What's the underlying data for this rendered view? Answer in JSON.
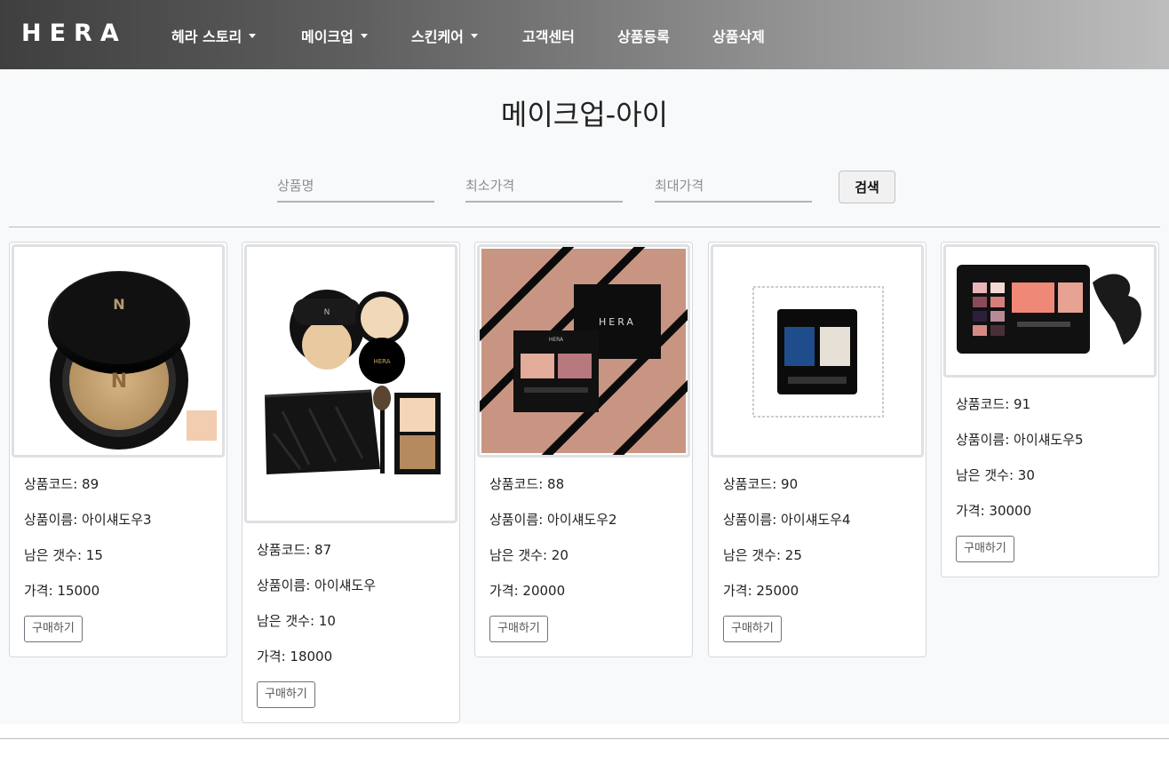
{
  "nav": {
    "brand": "HERA",
    "items": [
      {
        "label": "헤라 스토리",
        "dropdown": true
      },
      {
        "label": "메이크업",
        "dropdown": true
      },
      {
        "label": "스킨케어",
        "dropdown": true
      },
      {
        "label": "고객센터",
        "dropdown": false
      },
      {
        "label": "상품등록",
        "dropdown": false
      },
      {
        "label": "상품삭제",
        "dropdown": false
      }
    ]
  },
  "page": {
    "title": "메이크업-아이"
  },
  "search": {
    "name_placeholder": "상품명",
    "min_price_placeholder": "최소가격",
    "max_price_placeholder": "최대가격",
    "button_label": "검색"
  },
  "products": [
    {
      "code_line": "상품코드: 89",
      "name_line": "상품이름: 아이섀도우3",
      "stock_line": "남은 갯수: 15",
      "price_line": "가격: 15000",
      "buy_label": "구매하기",
      "image_icon": "cushion-compact-icon"
    },
    {
      "code_line": "상품코드: 87",
      "name_line": "상품이름: 아이섀도우",
      "stock_line": "남은 갯수: 10",
      "price_line": "가격: 18000",
      "buy_label": "구매하기",
      "image_icon": "makeup-set-icon"
    },
    {
      "code_line": "상품코드: 88",
      "name_line": "상품이름: 아이섀도우2",
      "stock_line": "남은 갯수: 20",
      "price_line": "가격: 20000",
      "buy_label": "구매하기",
      "image_icon": "eyeshadow-duo-pink-icon"
    },
    {
      "code_line": "상품코드: 90",
      "name_line": "상품이름: 아이섀도우4",
      "stock_line": "남은 갯수: 25",
      "price_line": "가격: 25000",
      "buy_label": "구매하기",
      "image_icon": "eyeshadow-duo-blue-icon"
    },
    {
      "code_line": "상품코드: 91",
      "name_line": "상품이름: 아이섀도우5",
      "stock_line": "남은 갯수: 30",
      "price_line": "가격: 30000",
      "buy_label": "구매하기",
      "image_icon": "eyeshadow-palette-icon"
    }
  ],
  "colors": {
    "nav_gradient_start": "#3f3f3f",
    "nav_gradient_end": "#bdbdbd",
    "background": "#f8f9fa"
  }
}
